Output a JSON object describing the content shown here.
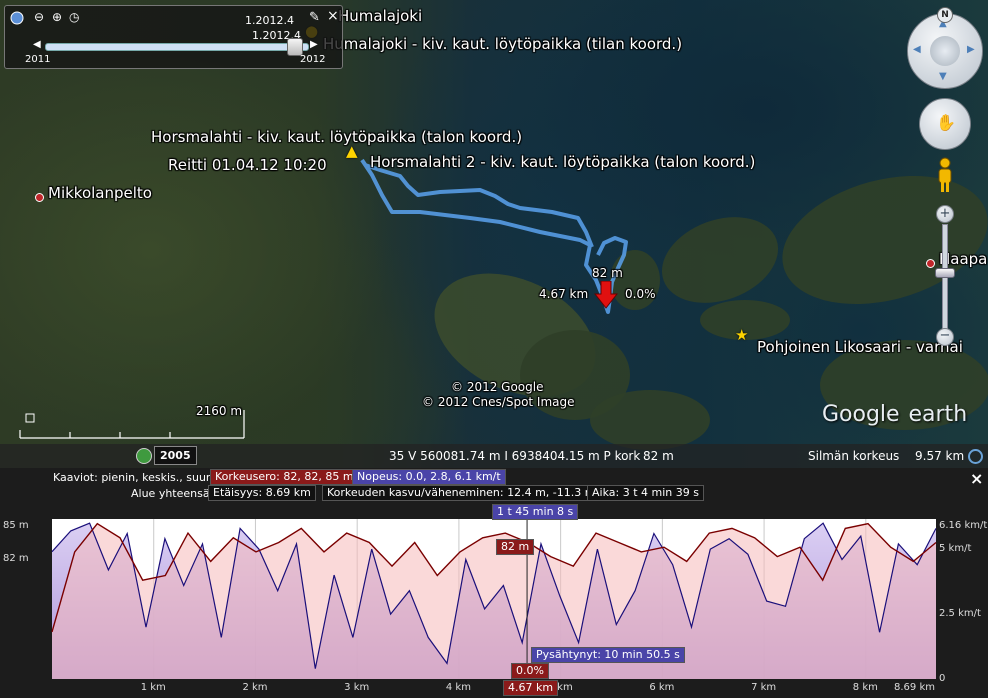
{
  "timeslider": {
    "label_top": "1.2012.4",
    "label_mid": "1.2012.4",
    "start_year": "2011",
    "end_year": "2012"
  },
  "map": {
    "places": [
      {
        "name": "Humalajoki"
      },
      {
        "name": "Humalajoki - kiv. kaut. löytöpaikka (tilan koord.)"
      },
      {
        "name": "Horsmalahti - kiv. kaut. löytöpaikka (talon koord.)"
      },
      {
        "name": "Horsmalahti 2 - kiv. kaut. löytöpaikka (talon koord.)"
      },
      {
        "name": "Mikkolanpelto"
      },
      {
        "name": "Haapa"
      },
      {
        "name": "Pohjoinen Likosaari - varhai"
      }
    ],
    "route_label": "Reitti 01.04.12 10:20",
    "marker_elevation": "82 m",
    "marker_distance": "4.67 km",
    "marker_grade": "0.0%",
    "copyright_1": "© 2012 Google",
    "copyright_2": "© 2012 Cnes/Spot Image",
    "scale": "2160 m",
    "logo_google": "Google",
    "logo_earth": "earth",
    "compass_n": "N"
  },
  "statusbar": {
    "year": "2005",
    "coords": "35 V 560081.74 m I 6938404.15 m P  kork",
    "elev": "82 m",
    "eye_label": "Silmän korkeus",
    "eye_value": "9.57 km"
  },
  "profile": {
    "legend_label": "Kaaviot: pienin, keskis., suurin",
    "legend_elev": "Korkeusero: 82, 82, 85 m",
    "legend_speed": "Nopeus: 0.0, 2.8, 6.1 km/t",
    "totals_label": "Alue yhteensä:",
    "distance": "Etäisyys: 8.69 km",
    "gain_loss": "Korkeuden kasvu/väheneminen: 12.4 m, -11.3 m",
    "time": "Aika: 3 t 4 min 39 s",
    "cursor_time": "1 t 45 min 8 s",
    "cursor_elev": "82 m",
    "cursor_grade": "0.0%",
    "cursor_dist": "4.67 km",
    "stopped": "Pysähtynyt: 10 min 50.5 s",
    "close_icon": "close-icon"
  },
  "chart_data": {
    "type": "line",
    "x_unit": "km",
    "xlim": [
      0,
      8.69
    ],
    "x_ticks": [
      "1 km",
      "2 km",
      "3 km",
      "4 km",
      "5 km",
      "6 km",
      "7 km",
      "8 km",
      "8.69 km"
    ],
    "y_left_ticks": [
      "85 m",
      "82 m"
    ],
    "y_right_ticks": [
      "6.16 km/t",
      "5 km/t",
      "2.5 km/t",
      "0"
    ],
    "ylim_elevation": [
      81.7,
      85.1
    ],
    "ylim_speed": [
      0,
      6.16
    ],
    "cursor_x": 4.67,
    "series": [
      {
        "name": "Korkeusero",
        "values": [
          82.7,
          84.4,
          85.0,
          84.7,
          83.8,
          83.9,
          84.8,
          84.2,
          84.7,
          84.4,
          84.6,
          84.9,
          84.4,
          84.8,
          84.6,
          84.1,
          84.6,
          83.9,
          84.4,
          84.7,
          84.8,
          84.6,
          84.3,
          84.1,
          84.8,
          84.6,
          84.4,
          84.5,
          84.2,
          84.8,
          84.9,
          84.7,
          84.3,
          84.5,
          83.8,
          84.9,
          85.0,
          84.5,
          84.2,
          84.6
        ]
      },
      {
        "name": "Nopeus",
        "values": [
          4.9,
          5.7,
          6.0,
          4.2,
          5.6,
          2.0,
          5.4,
          3.6,
          5.2,
          1.6,
          5.8,
          5.0,
          3.4,
          5.2,
          0.4,
          4.0,
          1.6,
          5.0,
          2.5,
          3.4,
          1.6,
          0.6,
          4.6,
          2.7,
          3.6,
          1.4,
          5.2,
          3.2,
          1.4,
          5.0,
          2.1,
          3.4,
          5.6,
          4.4,
          2.0,
          5.0,
          5.4,
          4.8,
          3.0,
          2.8,
          5.4,
          6.0,
          4.6,
          5.5,
          1.8,
          5.2,
          4.4,
          5.8
        ]
      }
    ]
  }
}
